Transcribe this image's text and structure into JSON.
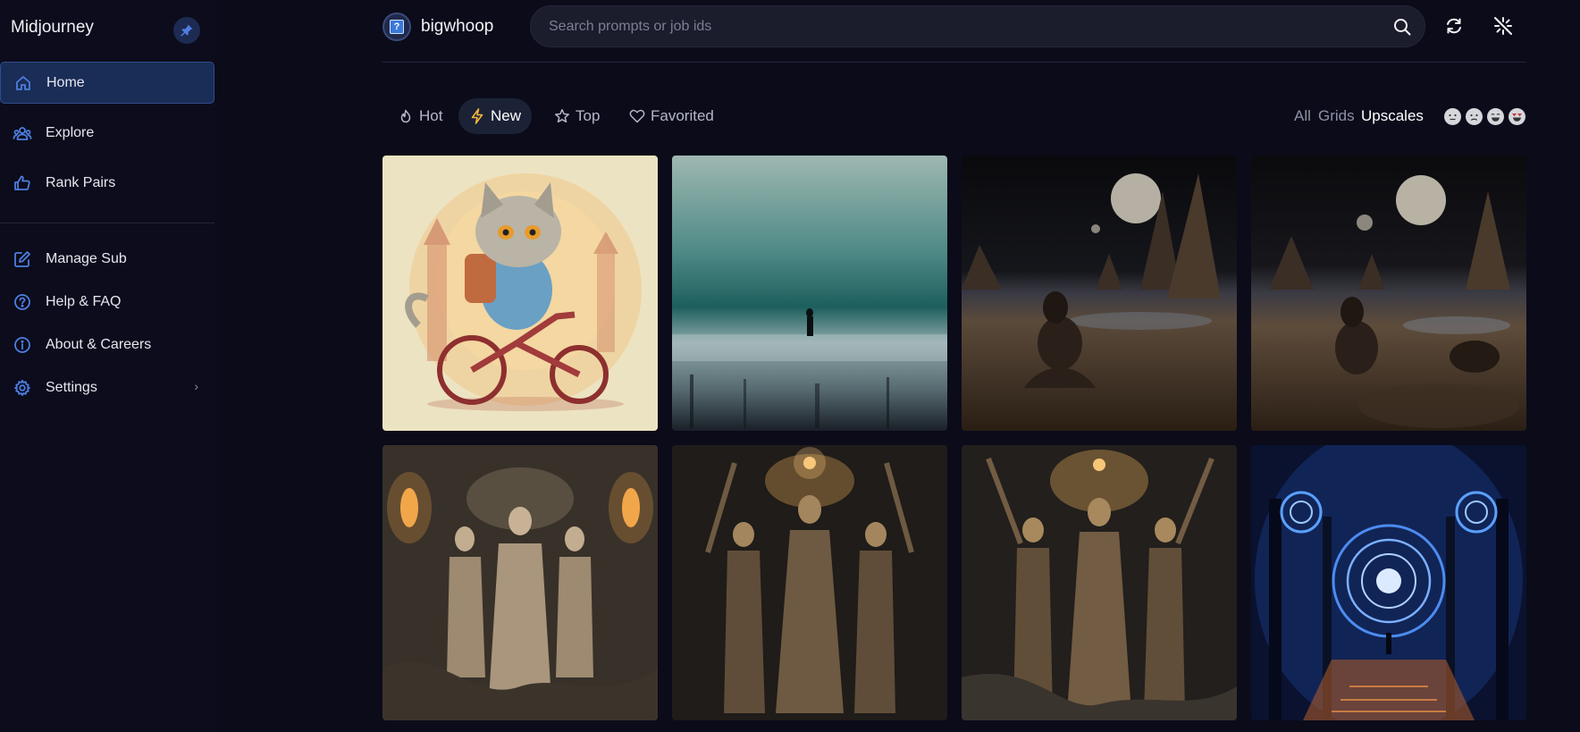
{
  "sidebar": {
    "brand": "Midjourney",
    "pin_icon": "pin-icon",
    "items": [
      {
        "label": "Home",
        "icon": "home-icon"
      },
      {
        "label": "Explore",
        "icon": "people-icon"
      },
      {
        "label": "Rank Pairs",
        "icon": "thumbs-up-icon"
      }
    ],
    "items2": [
      {
        "label": "Manage Sub",
        "icon": "edit-icon"
      },
      {
        "label": "Help & FAQ",
        "icon": "help-icon"
      },
      {
        "label": "About & Careers",
        "icon": "info-icon"
      },
      {
        "label": "Settings",
        "icon": "gear-icon"
      }
    ]
  },
  "header": {
    "username": "bigwhoop",
    "avatar_glyph": "?",
    "search_placeholder": "Search prompts or job ids"
  },
  "tabs": [
    {
      "label": "Hot",
      "icon": "flame-icon"
    },
    {
      "label": "New",
      "icon": "bolt-icon"
    },
    {
      "label": "Top",
      "icon": "star-icon"
    },
    {
      "label": "Favorited",
      "icon": "heart-icon"
    }
  ],
  "active_tab": "New",
  "filters": [
    "All",
    "Grids",
    "Upscales"
  ],
  "active_filter": "Upscales",
  "emoji_filters": [
    "neutral",
    "sad",
    "happy",
    "love"
  ],
  "gallery": [
    "cat riding a bicycle illustration",
    "lone figure on misty teal shore",
    "woman sitting on lunar landscape",
    "woman sitting on lunar landscape variation",
    "three goddesses with torches",
    "three goddesses with halo",
    "three goddesses raising arms",
    "blue glowing portal with figure"
  ],
  "colors": {
    "accent": "#4d7ee0",
    "background": "#0b0b1a",
    "active_nav": "#1a2d56"
  }
}
